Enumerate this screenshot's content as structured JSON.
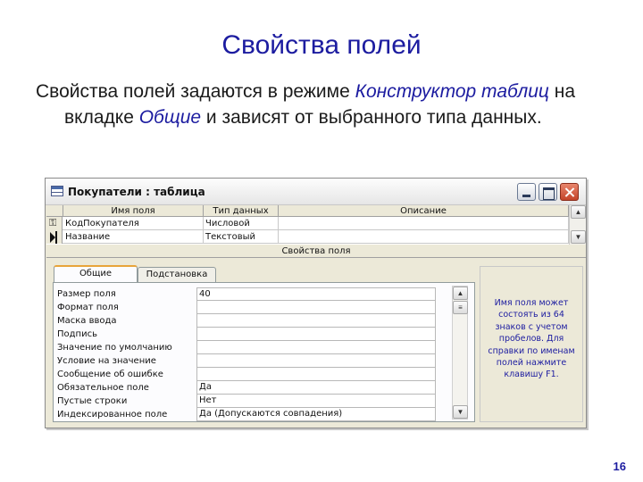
{
  "slide": {
    "title": "Свойства полей",
    "text_1": "Свойства полей задаются в режиме ",
    "text_em_1": "Конструктор таблиц",
    "text_2": " на вкладке ",
    "text_em_2": "Общие",
    "text_3": " и зависят от выбранного типа данных.",
    "page_number": "16"
  },
  "window": {
    "title": "Покупатели : таблица",
    "columns": [
      "Имя поля",
      "Тип данных",
      "Описание"
    ],
    "rows": [
      {
        "name": "КодПокупателя",
        "type": "Числовой",
        "description": "",
        "marker": "key-icon"
      },
      {
        "name": "Название",
        "type": "Текстовый",
        "description": "",
        "marker": "current-row-arrow-icon"
      }
    ],
    "field_props_label": "Свойства поля",
    "tabs": [
      "Общие",
      "Подстановка"
    ],
    "active_tab": "Общие",
    "properties": [
      {
        "name": "Размер поля",
        "value": "40"
      },
      {
        "name": "Формат поля",
        "value": ""
      },
      {
        "name": "Маска ввода",
        "value": ""
      },
      {
        "name": "Подпись",
        "value": ""
      },
      {
        "name": "Значение по умолчанию",
        "value": ""
      },
      {
        "name": "Условие на значение",
        "value": ""
      },
      {
        "name": "Сообщение об ошибке",
        "value": ""
      },
      {
        "name": "Обязательное поле",
        "value": "Да"
      },
      {
        "name": "Пустые строки",
        "value": "Нет"
      },
      {
        "name": "Индексированное поле",
        "value": "Да (Допускаются совпадения)"
      }
    ],
    "help_text": "Имя поля может состоять из 64 знаков с учетом пробелов. Для справки по именам полей нажмите клавишу F1."
  }
}
